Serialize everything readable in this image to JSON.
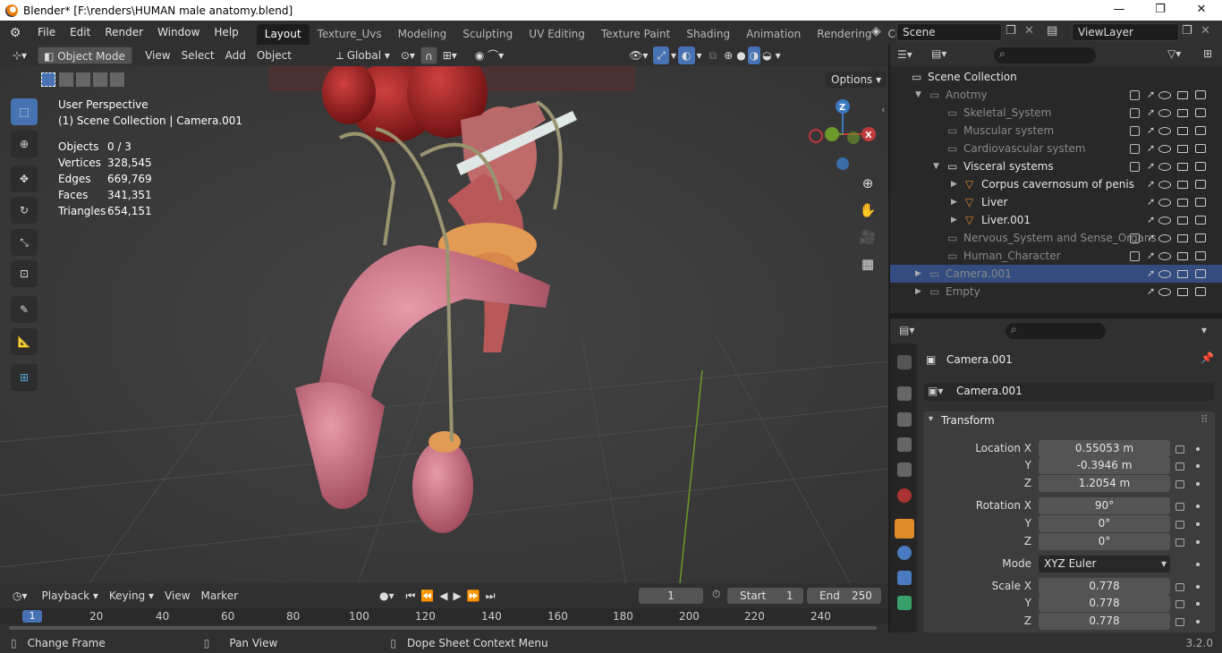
{
  "window": {
    "title": "Blender* [F:\\renders\\HUMAN male anatomy.blend]",
    "min": "—",
    "max": "❐",
    "close": "✕"
  },
  "menu": [
    "File",
    "Edit",
    "Render",
    "Window",
    "Help"
  ],
  "workspaces": [
    "Layout",
    "Texture_Uvs",
    "Modeling",
    "Sculpting",
    "UV Editing",
    "Texture Paint",
    "Shading",
    "Animation",
    "Rendering",
    "Compositing"
  ],
  "scene": "Scene",
  "view_layer": "ViewLayer",
  "header": {
    "mode": "Object Mode",
    "menus": [
      "View",
      "Select",
      "Add",
      "Object"
    ],
    "orientation": "Global",
    "options": "Options"
  },
  "overlay_text": {
    "perspective": "User Perspective",
    "collection": "(1) Scene Collection | Camera.001"
  },
  "stats": [
    {
      "label": "Objects",
      "value": "0 / 3"
    },
    {
      "label": "Vertices",
      "value": "328,545"
    },
    {
      "label": "Edges",
      "value": "669,769"
    },
    {
      "label": "Faces",
      "value": "341,351"
    },
    {
      "label": "Triangles",
      "value": "654,151"
    }
  ],
  "gizmo": {
    "z": "Z",
    "x": "X"
  },
  "timeline": {
    "menus": [
      "Playback",
      "Keying",
      "View",
      "Marker"
    ],
    "current_frame": "1",
    "start_label": "Start",
    "start": "1",
    "end_label": "End",
    "end": "250",
    "ticks": [
      "1",
      "20",
      "40",
      "60",
      "80",
      "100",
      "120",
      "140",
      "160",
      "180",
      "200",
      "220",
      "240"
    ]
  },
  "outliner": {
    "root": "Scene Collection",
    "rows": [
      {
        "label": "Anotmy",
        "indent": 1,
        "dim": true
      },
      {
        "label": "Skeletal_System",
        "indent": 2,
        "dim": true
      },
      {
        "label": "Muscular system",
        "indent": 2,
        "dim": true
      },
      {
        "label": "Cardiovascular system",
        "indent": 2,
        "dim": true
      },
      {
        "label": "Visceral systems",
        "indent": 2,
        "dim": false
      },
      {
        "label": "Corpus cavernosum of penis",
        "indent": 3,
        "dim": false
      },
      {
        "label": "Liver",
        "indent": 3,
        "dim": false
      },
      {
        "label": "Liver.001",
        "indent": 3,
        "dim": false
      },
      {
        "label": "Nervous_System and Sense_Organs",
        "indent": 2,
        "dim": true
      },
      {
        "label": "Human_Character",
        "indent": 2,
        "dim": true
      },
      {
        "label": "Camera.001",
        "indent": 1,
        "dim": true
      },
      {
        "label": "Empty",
        "indent": 1,
        "dim": true
      }
    ]
  },
  "properties": {
    "object": "Camera.001",
    "object_field": "Camera.001",
    "panel": "Transform",
    "location": {
      "label": "Location X",
      "x": "0.55053 m",
      "y": "-0.3946 m",
      "z": "1.2054 m"
    },
    "rotation": {
      "label": "Rotation X",
      "x": "90°",
      "y": "0°",
      "z": "0°"
    },
    "mode_label": "Mode",
    "mode": "XYZ Euler",
    "scale": {
      "label": "Scale X",
      "x": "0.778",
      "y": "0.778",
      "z": "0.778"
    },
    "y": "Y",
    "z": "Z"
  },
  "status": {
    "change_frame": "Change Frame",
    "pan_view": "Pan View",
    "context_menu": "Dope Sheet Context Menu",
    "version": "3.2.0"
  }
}
